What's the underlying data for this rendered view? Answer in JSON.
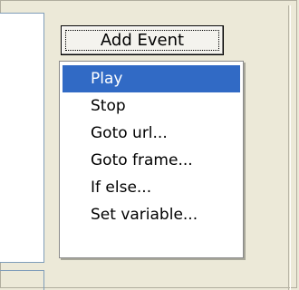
{
  "toolbar": {
    "add_event_label": "Add Event"
  },
  "menu": {
    "items": [
      {
        "label": "Play",
        "selected": true
      },
      {
        "label": "Stop",
        "selected": false
      },
      {
        "label": "Goto url...",
        "selected": false
      },
      {
        "label": "Goto frame...",
        "selected": false
      },
      {
        "label": "If else...",
        "selected": false
      },
      {
        "label": "Set variable...",
        "selected": false
      }
    ]
  },
  "colors": {
    "selection": "#316ac5",
    "window_bg": "#ece9d8",
    "border": "#7f9db9"
  }
}
